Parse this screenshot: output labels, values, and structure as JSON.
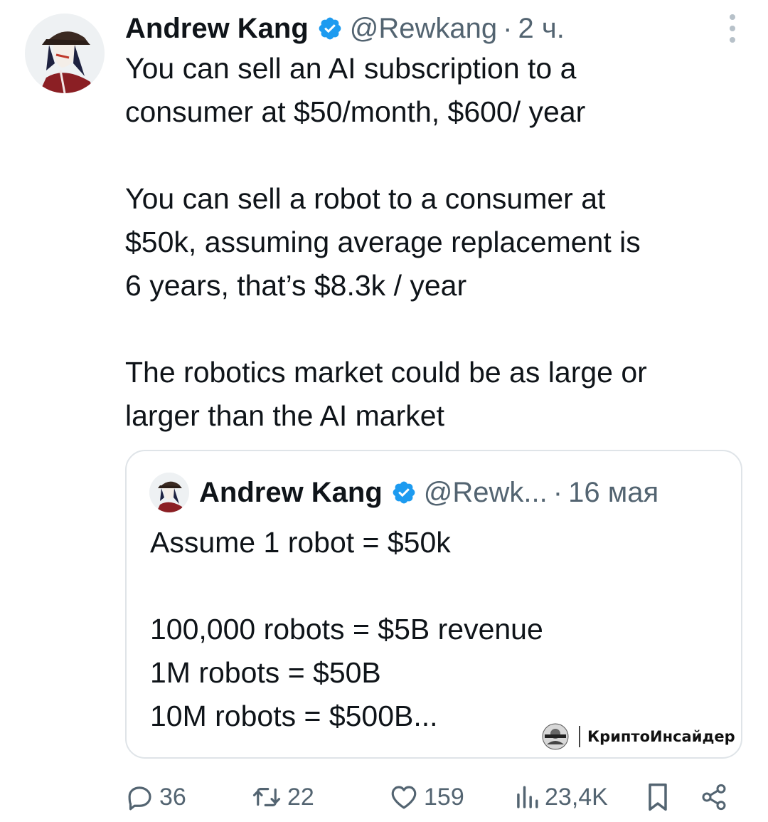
{
  "tweet": {
    "author_name": "Andrew Kang",
    "handle": "@Rewkang",
    "separator": "·",
    "time": "2 ч.",
    "text": "You can sell an AI subscription to a\nconsumer at $50/month, $600/ year\n\nYou can sell a robot to a consumer at\n$50k, assuming average replacement is\n6 years, that’s $8.3k / year\n\nThe robotics market could be as large or\nlarger than the AI market"
  },
  "quoted_tweet": {
    "author_name": "Andrew Kang",
    "handle": "@Rewk...",
    "separator": "·",
    "time": "16 мая",
    "text": "Assume 1 robot = $50k\n\n100,000 robots = $5B revenue\n1M robots = $50B\n10M robots = $500B..."
  },
  "watermark": {
    "text": "КриптоИнсайдер"
  },
  "actions": {
    "replies": "36",
    "retweets": "22",
    "likes": "159",
    "views": "23,4K"
  },
  "icons": {
    "verified": "verified-badge-icon",
    "more": "more-options-icon",
    "reply": "reply-icon",
    "retweet": "retweet-icon",
    "like": "heart-icon",
    "views": "views-icon",
    "bookmark": "bookmark-icon",
    "share": "share-icon"
  },
  "colors": {
    "verified": "#1d9bf0",
    "text": "#0f1419",
    "muted": "#536471"
  }
}
